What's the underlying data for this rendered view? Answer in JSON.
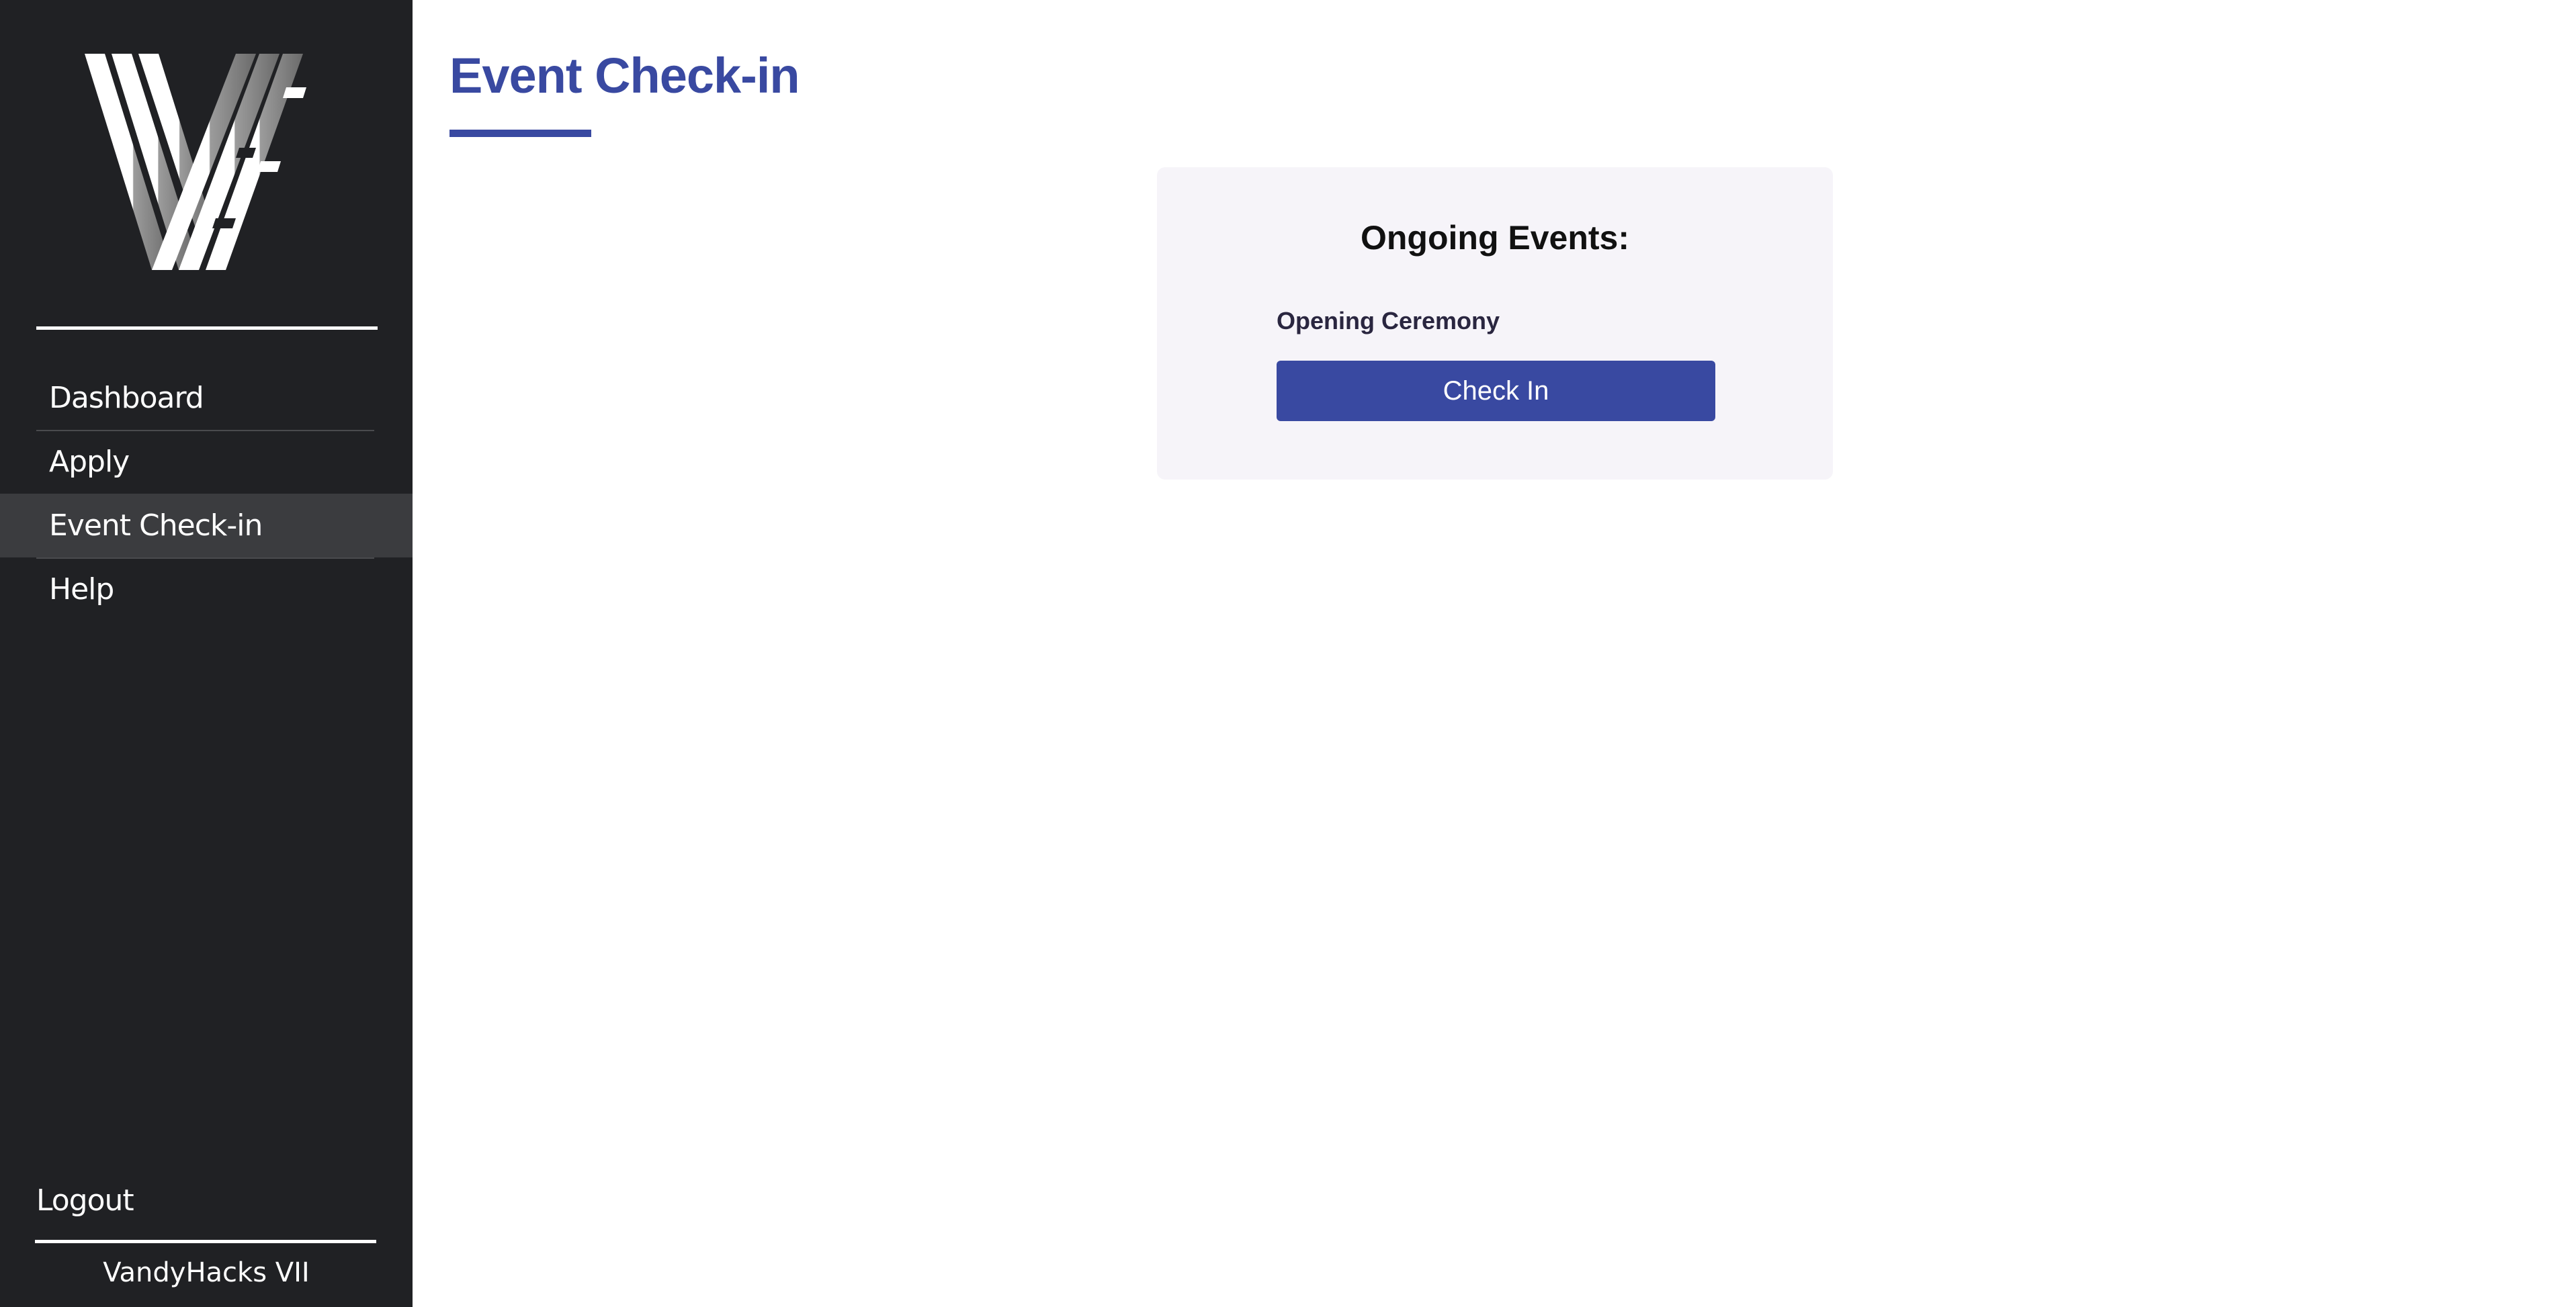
{
  "app": {
    "brand": "VandyHacks VII",
    "logo_icon": "vandyhacks-v-logo-icon"
  },
  "sidebar": {
    "items": [
      {
        "label": "Dashboard",
        "active": false
      },
      {
        "label": "Apply",
        "active": false
      },
      {
        "label": "Event Check-in",
        "active": true
      },
      {
        "label": "Help",
        "active": false
      }
    ],
    "logout_label": "Logout"
  },
  "main": {
    "title": "Event Check-in",
    "card": {
      "heading": "Ongoing Events:",
      "events": [
        {
          "name": "Opening Ceremony",
          "button_label": "Check In"
        }
      ]
    }
  },
  "colors": {
    "sidebar_bg": "#202124",
    "sidebar_active_bg": "#3b3c3f",
    "accent": "#3949a1",
    "card_bg": "#f6f4f9"
  }
}
